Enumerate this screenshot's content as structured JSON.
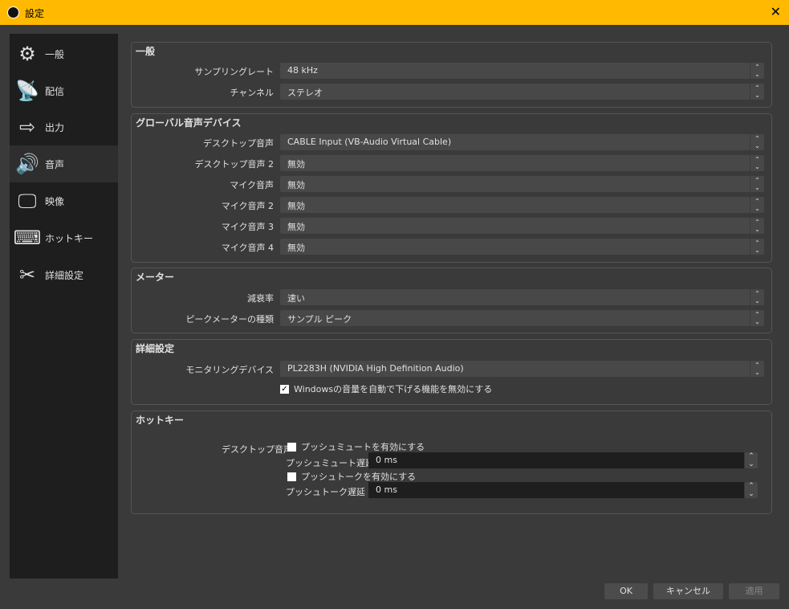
{
  "window": {
    "title": "設定",
    "close": "✕"
  },
  "sidebar": {
    "items": [
      {
        "label": "一般",
        "icon": "⚙"
      },
      {
        "label": "配信",
        "icon": "📡"
      },
      {
        "label": "出力",
        "icon": "⇨"
      },
      {
        "label": "音声",
        "icon": "🔊",
        "selected": true
      },
      {
        "label": "映像",
        "icon": "🖵"
      },
      {
        "label": "ホットキー",
        "icon": "⌨"
      },
      {
        "label": "詳細設定",
        "icon": "✂"
      }
    ]
  },
  "general": {
    "title": "一般",
    "sample_rate_label": "サンプリングレート",
    "sample_rate": "48 kHz",
    "channels_label": "チャンネル",
    "channels": "ステレオ"
  },
  "global": {
    "title": "グローバル音声デバイス",
    "rows": [
      {
        "label": "デスクトップ音声",
        "value": "CABLE Input (VB-Audio Virtual Cable)"
      },
      {
        "label": "デスクトップ音声 2",
        "value": "無効"
      },
      {
        "label": "マイク音声",
        "value": "無効"
      },
      {
        "label": "マイク音声 2",
        "value": "無効"
      },
      {
        "label": "マイク音声 3",
        "value": "無効"
      },
      {
        "label": "マイク音声 4",
        "value": "無効"
      }
    ]
  },
  "meters": {
    "title": "メーター",
    "decay_label": "減衰率",
    "decay": "速い",
    "peak_label": "ピークメーターの種類",
    "peak": "サンプル ピーク"
  },
  "advanced": {
    "title": "詳細設定",
    "monitor_label": "モニタリングデバイス",
    "monitor": "PL2283H (NVIDIA High Definition Audio)",
    "ducking_label": "Windowsの音量を自動で下げる機能を無効にする",
    "ducking_checked": true
  },
  "hotkeys": {
    "title": "ホットキー",
    "source_label": "デスクトップ音声",
    "ptm_label": "プッシュミュートを有効にする",
    "ptm_checked": false,
    "ptm_delay_label": "プッシュミュート遅延",
    "ptm_delay": "0 ms",
    "ptt_label": "プッシュトークを有効にする",
    "ptt_checked": false,
    "ptt_delay_label": "プッシュトーク遅延",
    "ptt_delay": "0 ms"
  },
  "buttons": {
    "ok": "OK",
    "cancel": "キャンセル",
    "apply": "適用"
  }
}
